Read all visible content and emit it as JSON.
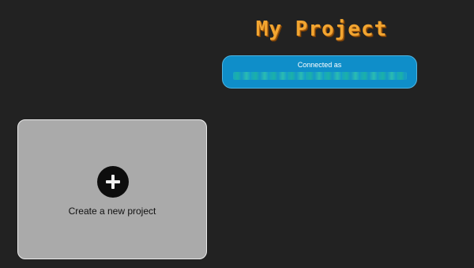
{
  "header": {
    "title": "My Project"
  },
  "wallet": {
    "label": "Connected as",
    "address": "···· ·· ··· ·· ·· ··· ······ ··· ·· ··· ····· ····· ·· ··· ·· ····· ·· ·· ···· ···· ···· ···· ···· ·· ···· ·· ·"
  },
  "projects": {
    "create_label": "Create a new project",
    "create_icon": "plus-icon"
  },
  "colors": {
    "background": "#222222",
    "title": "#f2a530",
    "wallet_bg": "#0f8ec9",
    "card_bg": "#aaaaaa"
  }
}
